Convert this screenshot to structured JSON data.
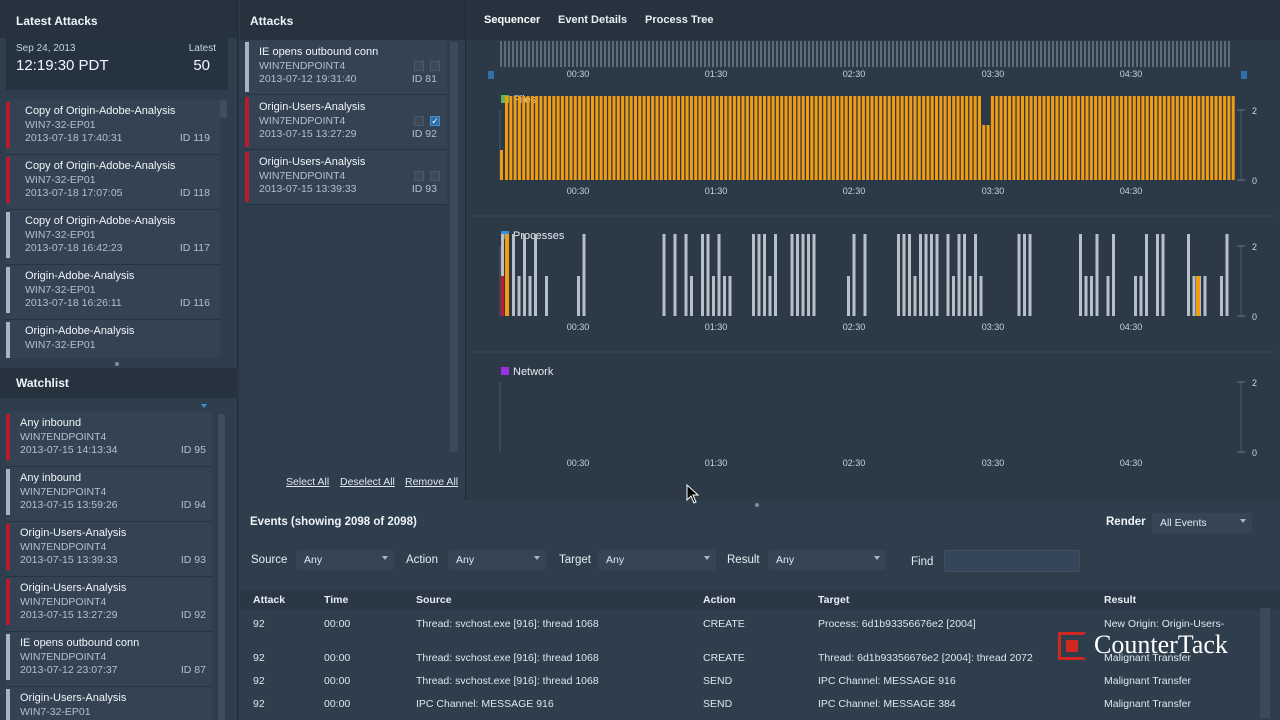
{
  "latest_attacks": {
    "title": "Latest Attacks",
    "date": "Sep 24, 2013",
    "time": "12:19:30 PDT",
    "latest_label": "Latest",
    "latest_count": "50",
    "items": [
      {
        "name": "Copy of Origin-Adobe-Analysis",
        "host": "WIN7-32-EP01",
        "date": "2013-07-18 17:40:31",
        "id": "ID 119",
        "status": "red"
      },
      {
        "name": "Copy of Origin-Adobe-Analysis",
        "host": "WIN7-32-EP01",
        "date": "2013-07-18 17:07:05",
        "id": "ID 118",
        "status": "red"
      },
      {
        "name": "Copy of Origin-Adobe-Analysis",
        "host": "WIN7-32-EP01",
        "date": "2013-07-18 16:42:23",
        "id": "ID 117",
        "status": "gray"
      },
      {
        "name": "Origin-Adobe-Analysis",
        "host": "WIN7-32-EP01",
        "date": "2013-07-18 16:26:11",
        "id": "ID 116",
        "status": "gray"
      },
      {
        "name": "Origin-Adobe-Analysis",
        "host": "WIN7-32-EP01",
        "date": "",
        "id": "",
        "status": "gray"
      }
    ]
  },
  "watchlist": {
    "title": "Watchlist",
    "items": [
      {
        "name": "Any inbound",
        "host": "WIN7ENDPOINT4",
        "date": "2013-07-15 14:13:34",
        "id": "ID 95",
        "status": "red"
      },
      {
        "name": "Any inbound",
        "host": "WIN7ENDPOINT4",
        "date": "2013-07-15 13:59:26",
        "id": "ID 94",
        "status": "gray"
      },
      {
        "name": "Origin-Users-Analysis",
        "host": "WIN7ENDPOINT4",
        "date": "2013-07-15 13:39:33",
        "id": "ID 93",
        "status": "red"
      },
      {
        "name": "Origin-Users-Analysis",
        "host": "WIN7ENDPOINT4",
        "date": "2013-07-15 13:27:29",
        "id": "ID 92",
        "status": "red"
      },
      {
        "name": "IE opens outbound conn",
        "host": "WIN7ENDPOINT4",
        "date": "2013-07-12 23:07:37",
        "id": "ID 87",
        "status": "gray"
      },
      {
        "name": "Origin-Users-Analysis",
        "host": "WIN7-32-EP01",
        "date": "",
        "id": "",
        "status": "gray"
      }
    ]
  },
  "attacks_panel": {
    "title": "Attacks",
    "items": [
      {
        "name": "IE opens outbound conn",
        "host": "WIN7ENDPOINT4",
        "date": "2013-07-12 19:31:40",
        "id": "ID 81",
        "status": "gray",
        "checked": false
      },
      {
        "name": "Origin-Users-Analysis",
        "host": "WIN7ENDPOINT4",
        "date": "2013-07-15 13:27:29",
        "id": "ID 92",
        "status": "red",
        "checked": true
      },
      {
        "name": "Origin-Users-Analysis",
        "host": "WIN7ENDPOINT4",
        "date": "2013-07-15 13:39:33",
        "id": "ID 93",
        "status": "red",
        "checked": false
      }
    ],
    "select_all": "Select All",
    "deselect_all": "Deselect All",
    "remove_all": "Remove All"
  },
  "tabs": [
    "Sequencer",
    "Event Details",
    "Process Tree"
  ],
  "active_tab": "Sequencer",
  "chart_data": {
    "type": "bar",
    "x_ticks": [
      "00:30",
      "01:30",
      "02:30",
      "03:30",
      "04:30"
    ],
    "panels": [
      {
        "name": "Files",
        "color": "#f39c12",
        "y_ticks": [
          "2",
          "0"
        ],
        "legend_color": "#5cb85c"
      },
      {
        "name": "Processes",
        "color": "#b7c0c8",
        "y_ticks": [
          "2",
          "0"
        ],
        "legend_color": "#3a8fd6"
      },
      {
        "name": "Network",
        "color": "#b7c0c8",
        "y_ticks": [
          "2",
          "0"
        ],
        "legend_color": "#9b30e0"
      }
    ]
  },
  "events": {
    "title": "Events (showing 2098 of 2098)",
    "render_label": "Render",
    "render_value": "All Events",
    "filters": {
      "source_label": "Source",
      "source_value": "Any",
      "action_label": "Action",
      "action_value": "Any",
      "target_label": "Target",
      "target_value": "Any",
      "result_label": "Result",
      "result_value": "Any",
      "find_label": "Find"
    },
    "columns": [
      "Attack",
      "Time",
      "Source",
      "Action",
      "Target",
      "Result"
    ],
    "rows": [
      {
        "attack": "92",
        "time": "00:00",
        "source": "Thread: svchost.exe [916]: thread 1068",
        "action": "CREATE",
        "target": "Process: 6d1b93356676e2 [2004]",
        "result": "New Origin: Origin-Users-"
      },
      {
        "attack": "92",
        "time": "00:00",
        "source": "Thread: svchost.exe [916]: thread 1068",
        "action": "CREATE",
        "target": "Thread: 6d1b93356676e2 [2004]: thread 2072",
        "result": "Malignant Transfer"
      },
      {
        "attack": "92",
        "time": "00:00",
        "source": "Thread: svchost.exe [916]: thread 1068",
        "action": "SEND",
        "target": "IPC Channel: MESSAGE 916",
        "result": "Malignant Transfer"
      },
      {
        "attack": "92",
        "time": "00:00",
        "source": "IPC Channel: MESSAGE 916",
        "action": "SEND",
        "target": "IPC Channel: MESSAGE 384",
        "result": "Malignant Transfer"
      }
    ]
  },
  "brand": "CounterTack"
}
